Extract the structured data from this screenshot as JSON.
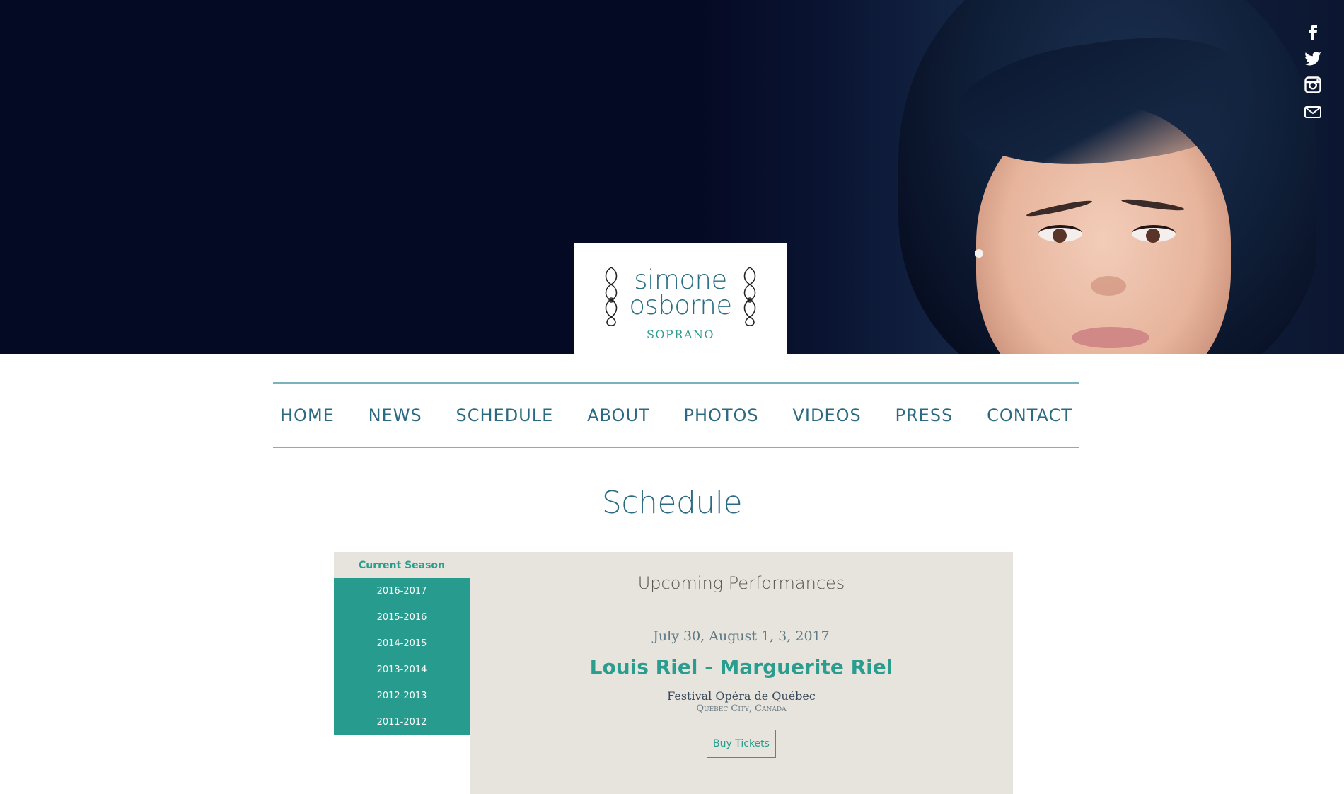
{
  "hero": {
    "social": [
      {
        "icon": "facebook-icon"
      },
      {
        "icon": "twitter-icon"
      },
      {
        "icon": "instagram-icon"
      },
      {
        "icon": "email-icon"
      }
    ]
  },
  "logo": {
    "name_line1": "simone",
    "name_line2": "osborne",
    "subtitle": "SOPRANO"
  },
  "nav": {
    "items": [
      "HOME",
      "NEWS",
      "SCHEDULE",
      "ABOUT",
      "PHOTOS",
      "VIDEOS",
      "PRESS",
      "CONTACT"
    ]
  },
  "page": {
    "title": "Schedule"
  },
  "schedule": {
    "current_season_label": "Current Season",
    "seasons": [
      "2016-2017",
      "2015-2016",
      "2014-2015",
      "2013-2014",
      "2012-2013",
      "2011-2012"
    ],
    "upcoming_heading": "Upcoming Performances",
    "performance": {
      "date": "July 30, August 1, 3, 2017",
      "title": "Louis Riel - Marguerite Riel",
      "venue": "Festival Opéra de Québec",
      "city": "Québec City, Canada",
      "buy_label": "Buy Tickets"
    }
  },
  "colors": {
    "accent_teal": "#2a9d8f",
    "nav_blue": "#2c6a82",
    "panel_bg": "#e7e4de",
    "hero_navy": "#050a24"
  }
}
